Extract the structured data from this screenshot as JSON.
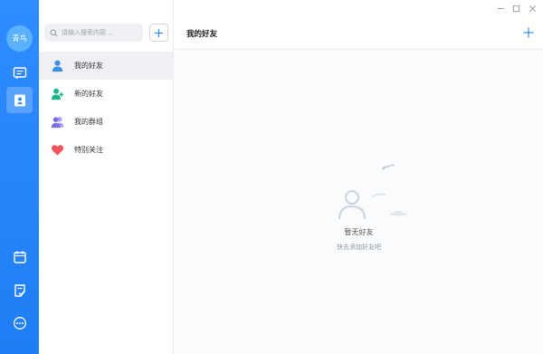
{
  "user": {
    "avatar_text": "青鸟"
  },
  "rail": {
    "items": [
      {
        "name": "chat",
        "icon": "chat-bubble-icon"
      },
      {
        "name": "contacts",
        "icon": "contacts-card-icon",
        "active": true
      },
      {
        "name": "calendar",
        "icon": "calendar-icon"
      },
      {
        "name": "notes",
        "icon": "note-edit-icon"
      },
      {
        "name": "more",
        "icon": "more-dots-icon"
      }
    ]
  },
  "search": {
    "placeholder": "请输入搜索内容..."
  },
  "contacts": {
    "items": [
      {
        "label": "我的好友",
        "icon": "user-icon",
        "active": true
      },
      {
        "label": "新的好友",
        "icon": "add-user-icon"
      },
      {
        "label": "我的群组",
        "icon": "group-icon"
      },
      {
        "label": "特别关注",
        "icon": "heart-icon"
      }
    ]
  },
  "main": {
    "title": "我的好友",
    "empty_title": "暂无好友",
    "empty_subtitle": "快去添加好友吧"
  },
  "colors": {
    "rail": "#2f8cff",
    "accent": "#2f8cff",
    "user_icon": "#3d8fe0",
    "add_user_icon": "#19b38c",
    "group_icon": "#7a6fe0",
    "heart_icon": "#f0545d"
  }
}
